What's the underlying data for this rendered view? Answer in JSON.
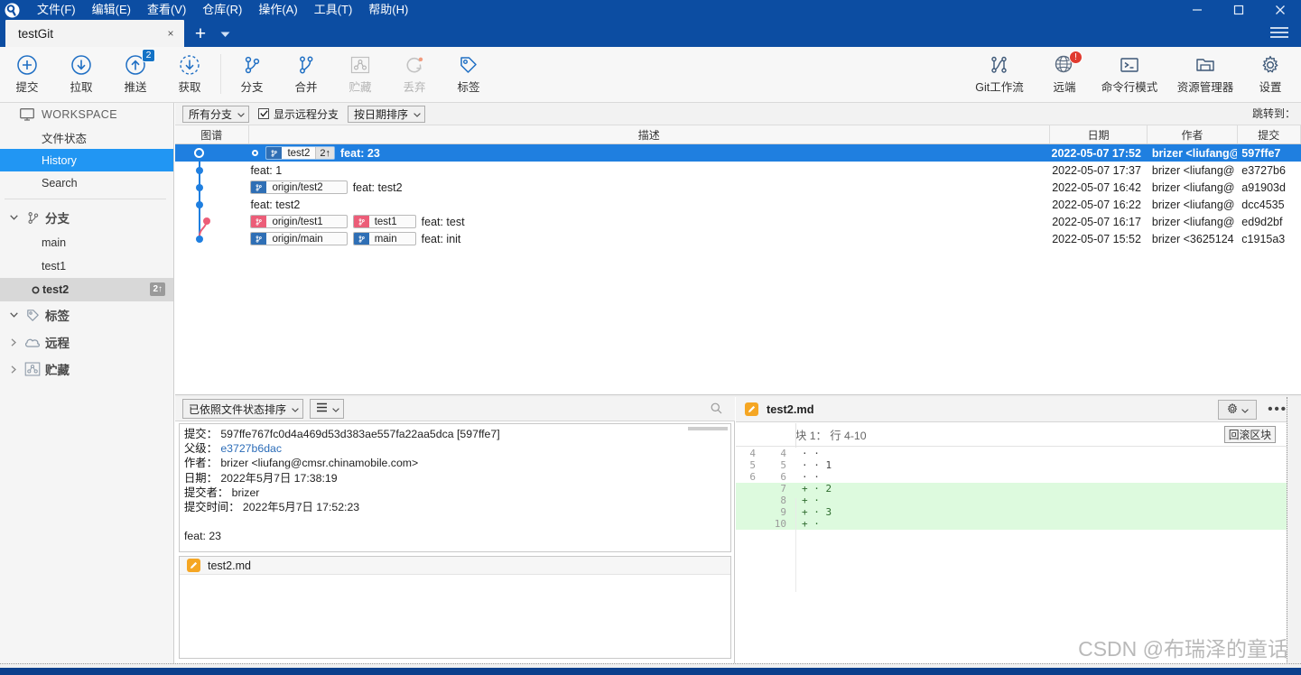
{
  "window": {
    "title": "testGit",
    "minimize_label": "minimize",
    "maximize_label": "maximize",
    "close_label": "close"
  },
  "menubar": [
    {
      "label": "文件(F)"
    },
    {
      "label": "编辑(E)"
    },
    {
      "label": "查看(V)"
    },
    {
      "label": "仓库(R)"
    },
    {
      "label": "操作(A)"
    },
    {
      "label": "工具(T)"
    },
    {
      "label": "帮助(H)"
    }
  ],
  "tabs": {
    "active": "testGit",
    "close_label": "×",
    "add_label": "+",
    "caret_label": "▾"
  },
  "toolbar": {
    "left": [
      {
        "label": "提交",
        "icon": "plus-circle-icon",
        "disabled": false,
        "badge": ""
      },
      {
        "label": "拉取",
        "icon": "arrow-down-circle-icon",
        "disabled": false,
        "badge": ""
      },
      {
        "label": "推送",
        "icon": "arrow-up-circle-icon",
        "disabled": false,
        "badge": "2"
      },
      {
        "label": "获取",
        "icon": "fetch-dashed-circle-icon",
        "disabled": false,
        "badge": ""
      },
      {
        "label": "分支",
        "icon": "branch-icon",
        "disabled": false,
        "badge": ""
      },
      {
        "label": "合并",
        "icon": "merge-icon",
        "disabled": false,
        "badge": ""
      },
      {
        "label": "贮藏",
        "icon": "stash-icon",
        "disabled": true,
        "badge": ""
      },
      {
        "label": "丢弃",
        "icon": "discard-refresh-icon",
        "disabled": true,
        "badge": ""
      },
      {
        "label": "标签",
        "icon": "tag-icon",
        "disabled": false,
        "badge": ""
      }
    ],
    "right": [
      {
        "label": "Git工作流",
        "icon": "gitflow-icon",
        "badge": ""
      },
      {
        "label": "远端",
        "icon": "globe-icon",
        "badge": "!"
      },
      {
        "label": "命令行模式",
        "icon": "terminal-icon",
        "badge": ""
      },
      {
        "label": "资源管理器",
        "icon": "folder-icon",
        "badge": ""
      },
      {
        "label": "设置",
        "icon": "gear-icon",
        "badge": ""
      }
    ]
  },
  "sidebar": {
    "workspace_label": "WORKSPACE",
    "links": [
      {
        "label": "文件状态",
        "active": false
      },
      {
        "label": "History",
        "active": true
      },
      {
        "label": "Search",
        "active": false
      }
    ],
    "groups": [
      {
        "label": "分支",
        "icon": "branch-icon",
        "expanded": true,
        "branches": [
          {
            "label": "main",
            "current": false,
            "count": ""
          },
          {
            "label": "test1",
            "current": false,
            "count": ""
          },
          {
            "label": "test2",
            "current": true,
            "count": "2↑"
          }
        ]
      },
      {
        "label": "标签",
        "icon": "tag-icon",
        "expanded": true,
        "branches": []
      },
      {
        "label": "远程",
        "icon": "cloud-icon",
        "expanded": false,
        "branches": []
      },
      {
        "label": "贮藏",
        "icon": "stash-icon",
        "expanded": false,
        "branches": []
      }
    ]
  },
  "filterbar": {
    "branch_filter": "所有分支",
    "show_remote_label": "显示远程分支",
    "show_remote_checked": true,
    "sort_order": "按日期排序",
    "goto_label": "跳转到："
  },
  "commit_table": {
    "columns": [
      "图谱",
      "描述",
      "日期",
      "作者",
      "提交"
    ],
    "rows": [
      {
        "selected": true,
        "dot": true,
        "refs": [
          {
            "name": "test2",
            "count": "2↑",
            "color": "blue"
          }
        ],
        "message": "feat: 23",
        "date": "2022-05-07 17:52",
        "author": "brizer <liufang@",
        "sha": "597ffe7"
      },
      {
        "selected": false,
        "dot": false,
        "refs": [],
        "message": "feat: 1",
        "date": "2022-05-07 17:37",
        "author": "brizer <liufang@",
        "sha": "e3727b6"
      },
      {
        "selected": false,
        "dot": false,
        "refs": [
          {
            "name": "origin/test2",
            "count": "",
            "color": "blue"
          }
        ],
        "message": "feat: test2",
        "date": "2022-05-07 16:42",
        "author": "brizer <liufang@",
        "sha": "a91903d"
      },
      {
        "selected": false,
        "dot": false,
        "refs": [],
        "message": "feat: test2",
        "date": "2022-05-07 16:22",
        "author": "brizer <liufang@",
        "sha": "dcc4535"
      },
      {
        "selected": false,
        "dot": false,
        "refs": [
          {
            "name": "origin/test1",
            "count": "",
            "color": "pink"
          },
          {
            "name": "test1",
            "count": "",
            "color": "pink"
          }
        ],
        "message": "feat: test",
        "date": "2022-05-07 16:17",
        "author": "brizer <liufang@",
        "sha": "ed9d2bf"
      },
      {
        "selected": false,
        "dot": false,
        "refs": [
          {
            "name": "origin/main",
            "count": "",
            "color": "blue"
          },
          {
            "name": "main",
            "count": "",
            "color": "blue"
          }
        ],
        "message": "feat: init",
        "date": "2022-05-07 15:52",
        "author": "brizer <3625124",
        "sha": "c1915a3"
      }
    ]
  },
  "detail_panel": {
    "sort_combo": "已依照文件状态排序",
    "view_combo": "≡",
    "search_icon": "search-icon",
    "fields": [
      {
        "key": "提交：",
        "value": "597ffe767fc0d4a469d53d383ae557fa22aa5dca [597ffe7]",
        "link": false
      },
      {
        "key": "父级：",
        "value": "e3727b6dac",
        "link": true
      },
      {
        "key": "作者：",
        "value": "brizer <liufang@cmsr.chinamobile.com>",
        "link": false
      },
      {
        "key": "日期：",
        "value": "2022年5月7日 17:38:19",
        "link": false
      },
      {
        "key": "提交者：",
        "value": "brizer",
        "link": false
      },
      {
        "key": "提交时间：",
        "value": "2022年5月7日 17:52:23",
        "link": false
      }
    ],
    "commit_message": "feat: 23",
    "files": [
      {
        "name": "test2.md",
        "icon": "md-file-icon"
      }
    ]
  },
  "diff_panel": {
    "file_name": "test2.md",
    "file_icon": "md-file-icon",
    "gear_label": "gear-icon",
    "more_label": "•••",
    "hunk_label": "块 1： 行 4-10",
    "rollback_label": "回滚区块",
    "lines": [
      {
        "old": "4",
        "new": "4",
        "type": "ctx",
        "text": "· ·"
      },
      {
        "old": "5",
        "new": "5",
        "type": "ctx",
        "text": "· · 1"
      },
      {
        "old": "6",
        "new": "6",
        "type": "ctx",
        "text": "· ·"
      },
      {
        "old": "",
        "new": "7",
        "type": "add",
        "text": "+ · 2"
      },
      {
        "old": "",
        "new": "8",
        "type": "add",
        "text": "+ ·"
      },
      {
        "old": "",
        "new": "9",
        "type": "add",
        "text": "+ · 3"
      },
      {
        "old": "",
        "new": "10",
        "type": "add",
        "text": "+ ·"
      }
    ]
  },
  "watermark": "CSDN @布瑞泽的童话",
  "colors": {
    "accent": "#0c4da2",
    "selection": "#1f7fe0",
    "sidebar_active": "#2196f3",
    "ref_blue": "#2f6fb5",
    "ref_pink": "#ec5d78",
    "diff_add_bg": "#ddfade",
    "badge_blue": "#1473c6",
    "badge_red": "#e03a2f"
  }
}
